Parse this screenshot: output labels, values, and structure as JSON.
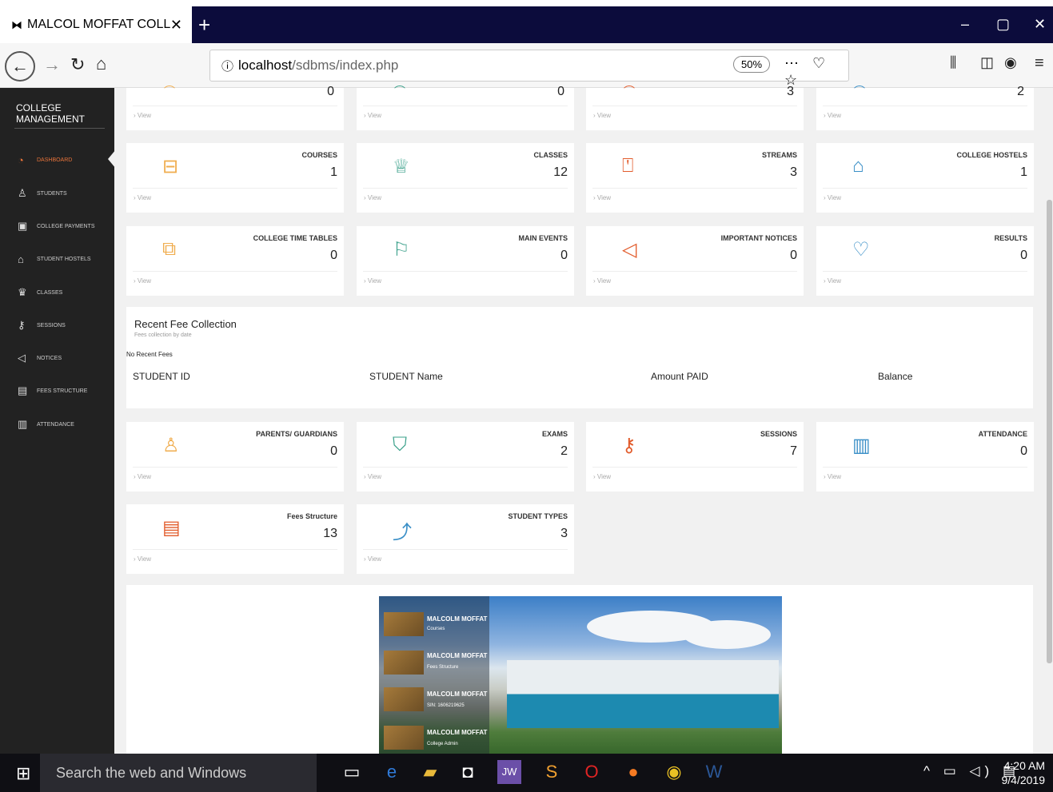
{
  "browser": {
    "tab_title": "MALCOL MOFFAT COLLEGE OF",
    "url_host": "localhost",
    "url_path": "/sdbms/index.php",
    "zoom": "50%"
  },
  "sidebar": {
    "brand": "COLLEGE MANAGEMENT",
    "items": [
      {
        "label": "Dashboard",
        "icon": "dashboard-icon"
      },
      {
        "label": "Students",
        "icon": "user-icon"
      },
      {
        "label": "College Payments",
        "icon": "payment-icon"
      },
      {
        "label": "Student Hostels",
        "icon": "home-icon"
      },
      {
        "label": "Classes",
        "icon": "crown-icon"
      },
      {
        "label": "Sessions",
        "icon": "key-icon"
      },
      {
        "label": "Notices",
        "icon": "megaphone-icon"
      },
      {
        "label": "Fees Structure",
        "icon": "document-icon"
      },
      {
        "label": "Attendance",
        "icon": "bar-chart-icon"
      }
    ]
  },
  "partial_values": [
    "0",
    "0",
    "3",
    "2"
  ],
  "view_label": "View",
  "cards_row1": [
    {
      "label": "COURSES",
      "value": "1",
      "icon": "server-icon",
      "color": "#f0ad4e"
    },
    {
      "label": "CLASSES",
      "value": "12",
      "icon": "crown-icon",
      "color": "#3aa08a"
    },
    {
      "label": "STREAMS",
      "value": "3",
      "icon": "presentation-icon",
      "color": "#e25c2c"
    },
    {
      "label": "COLLEGE HOSTELS",
      "value": "1",
      "icon": "home-icon",
      "color": "#3a8fc7"
    }
  ],
  "cards_row2": [
    {
      "label": "COLLEGE TIME TABLES",
      "value": "0",
      "icon": "copy-icon",
      "color": "#f0ad4e"
    },
    {
      "label": "MAIN EVENTS",
      "value": "0",
      "icon": "flag-icon",
      "color": "#3aa08a"
    },
    {
      "label": "IMPORTANT NOTICES",
      "value": "0",
      "icon": "megaphone-icon",
      "color": "#e25c2c"
    },
    {
      "label": "RESULTS",
      "value": "0",
      "icon": "trophy-icon",
      "color": "#3a8fc7"
    }
  ],
  "fees": {
    "title": "Recent Fee Collection",
    "subtitle": "Fees collection by date",
    "empty": "No Recent Fees",
    "headers": [
      "STUDENT ID",
      "STUDENT Name",
      "Amount PAID",
      "Balance"
    ]
  },
  "cards_row3": [
    {
      "label": "PARENTS/ GUARDIANS",
      "value": "0",
      "icon": "user-icon",
      "color": "#f0ad4e"
    },
    {
      "label": "EXAMS",
      "value": "2",
      "icon": "bookmark-icon",
      "color": "#3aa08a"
    },
    {
      "label": "SESSIONS",
      "value": "7",
      "icon": "key-icon",
      "color": "#e25c2c"
    },
    {
      "label": "ATTENDANCE",
      "value": "0",
      "icon": "bar-chart-icon",
      "color": "#3a8fc7"
    }
  ],
  "cards_row4": [
    {
      "label": "Fees Structure",
      "value": "13",
      "icon": "document-icon",
      "color": "#e25c2c"
    },
    {
      "label": "STUDENT TYPES",
      "value": "3",
      "icon": "trend-icon",
      "color": "#3a8fc7"
    }
  ],
  "slider": [
    {
      "title": "MALCOLM MOFFAT",
      "sub": "Courses"
    },
    {
      "title": "MALCOLM MOFFAT",
      "sub": "Fees Structure"
    },
    {
      "title": "MALCOLM MOFFAT",
      "sub": "SIN: 1606219625"
    },
    {
      "title": "MALCOLM MOFFAT",
      "sub": "College Admin"
    }
  ],
  "taskbar": {
    "search": "Search the web and Windows",
    "time": "4:20 AM",
    "date": "9/4/2019"
  }
}
